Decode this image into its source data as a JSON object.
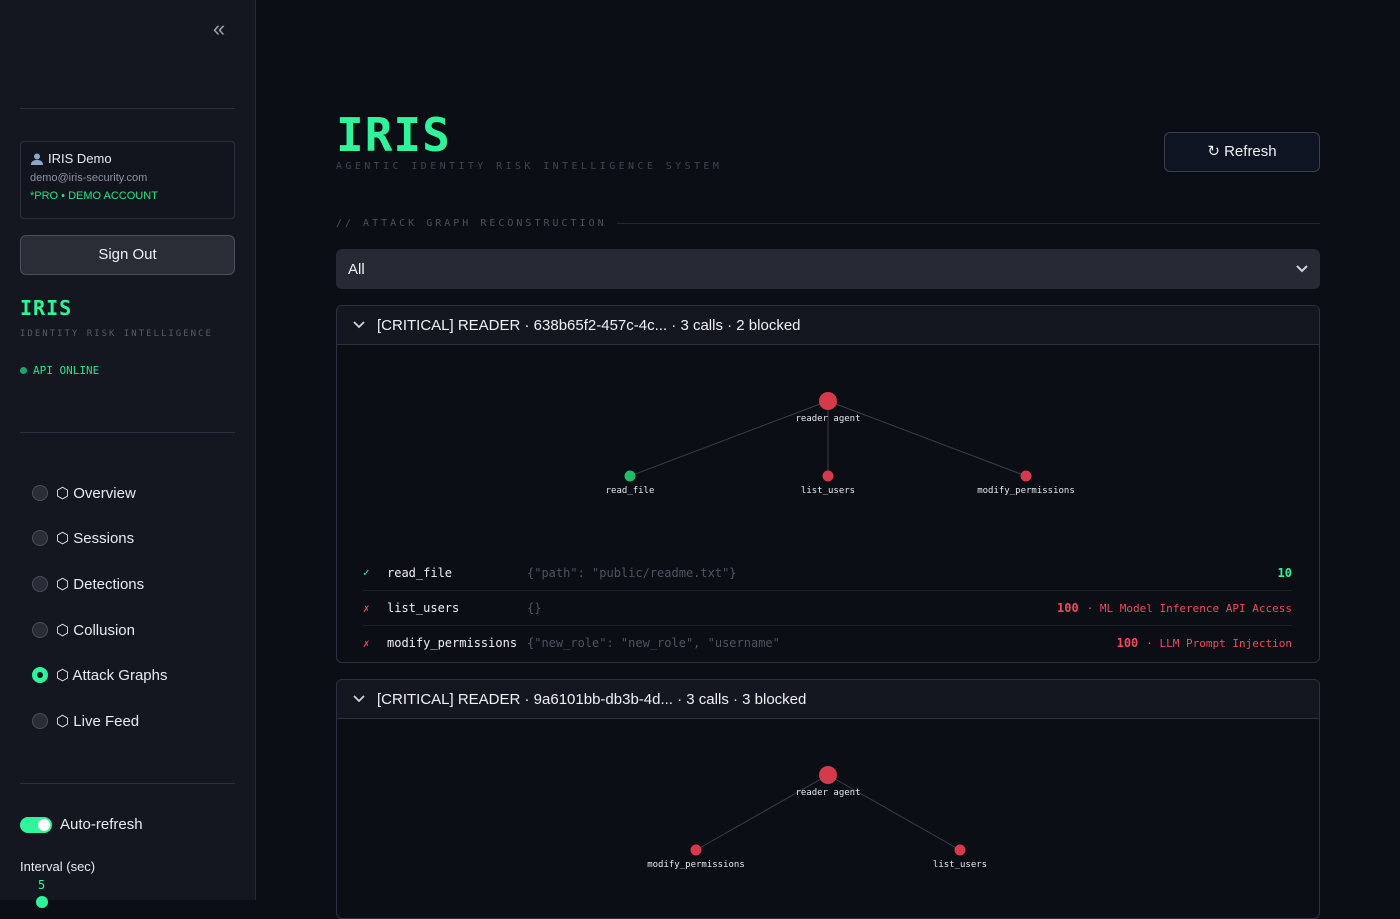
{
  "sidebar": {
    "collapse_icon": "double-chevron-left-icon",
    "user": {
      "name": "IRIS Demo",
      "email": "demo@iris-security.com",
      "plan": "*PRO • DEMO ACCOUNT"
    },
    "sign_out": "Sign Out",
    "brand": "IRIS",
    "brand_sub": "IDENTITY RISK INTELLIGENCE",
    "api_status": "API ONLINE",
    "nav": [
      {
        "label": "⬡ Overview",
        "selected": false
      },
      {
        "label": "⬡ Sessions",
        "selected": false
      },
      {
        "label": "⬡ Detections",
        "selected": false
      },
      {
        "label": "⬡ Collusion",
        "selected": false
      },
      {
        "label": "⬡ Attack Graphs",
        "selected": true
      },
      {
        "label": "⬡ Live Feed",
        "selected": false
      }
    ],
    "auto_refresh_label": "Auto-refresh",
    "auto_refresh_on": true,
    "interval_label": "Interval (sec)",
    "interval_value": "5"
  },
  "main": {
    "title": "IRIS",
    "subtitle": "AGENTIC IDENTITY RISK INTELLIGENCE SYSTEM",
    "refresh_label": "↻ Refresh",
    "section_label": "// ATTACK GRAPH RECONSTRUCTION",
    "filter_value": "All",
    "sessions": [
      {
        "title": "[CRITICAL] READER · 638b65f2-457c-4c... · 3 calls · 2 blocked",
        "root": "reader agent",
        "nodes": [
          {
            "label": "read_file",
            "status": "ok"
          },
          {
            "label": "list_users",
            "status": "blocked"
          },
          {
            "label": "modify_permissions",
            "status": "blocked"
          }
        ],
        "calls": [
          {
            "icon": "✓",
            "status": "ok",
            "name": "read_file",
            "args": "{\"path\": \"public/readme.txt\"}",
            "score": "10",
            "detection": ""
          },
          {
            "icon": "✗",
            "status": "bad",
            "name": "list_users",
            "args": "{}",
            "score": "100",
            "detection": "· ML Model Inference API Access"
          },
          {
            "icon": "✗",
            "status": "bad",
            "name": "modify_permissions",
            "args": "{\"new_role\": \"new_role\", \"username\"",
            "score": "100",
            "detection": "· LLM Prompt Injection"
          }
        ]
      },
      {
        "title": "[CRITICAL] READER · 9a6101bb-db3b-4d... · 3 calls · 3 blocked",
        "root": "reader agent",
        "nodes": [
          {
            "label": "modify_permissions",
            "status": "blocked"
          },
          {
            "label": "list_users",
            "status": "blocked"
          }
        ]
      }
    ]
  },
  "colors": {
    "accent": "#2ef59a",
    "danger": "#d43a4c",
    "ok_node": "#1fbf6a",
    "bg": "#0b0e14",
    "sidebar_bg": "#141720"
  }
}
